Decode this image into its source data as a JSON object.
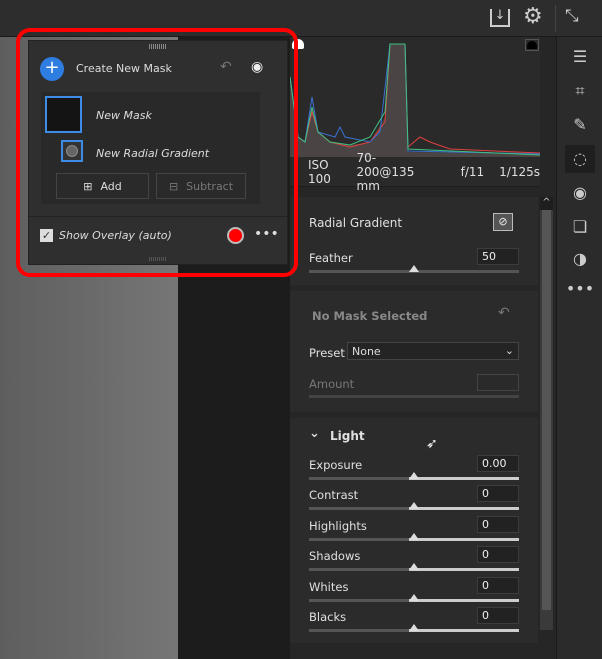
{
  "topbar": {
    "icons": [
      "save-icon",
      "gear-icon",
      "collapse-icon"
    ]
  },
  "histogram": {
    "iso": "ISO 100",
    "lens": "70-200@135 mm",
    "aperture": "f/11",
    "shutter": "1/125s"
  },
  "mask_panel": {
    "create_label": "Create New Mask",
    "mask_name": "New Mask",
    "component_name": "New Radial Gradient",
    "add_label": "Add",
    "subtract_label": "Subtract",
    "overlay_label": "Show Overlay (auto)",
    "overlay_checked": true,
    "overlay_color": "#ff0000"
  },
  "radial": {
    "title": "Radial Gradient",
    "feather_label": "Feather",
    "feather_value": "50",
    "feather_fraction": 0.5
  },
  "nomask": {
    "title": "No Mask Selected",
    "preset_label": "Preset",
    "preset_value": "None",
    "amount_label": "Amount"
  },
  "light": {
    "title": "Light",
    "sliders": [
      {
        "label": "Exposure",
        "value": "0.00"
      },
      {
        "label": "Contrast",
        "value": "0"
      },
      {
        "label": "Highlights",
        "value": "0"
      },
      {
        "label": "Shadows",
        "value": "0"
      },
      {
        "label": "Whites",
        "value": "0"
      },
      {
        "label": "Blacks",
        "value": "0"
      }
    ]
  },
  "tools": [
    "edit-icon",
    "crop-icon",
    "heal-icon",
    "mask-icon",
    "redeye-icon",
    "presets-icon",
    "snapshots-icon",
    "more-icon"
  ]
}
